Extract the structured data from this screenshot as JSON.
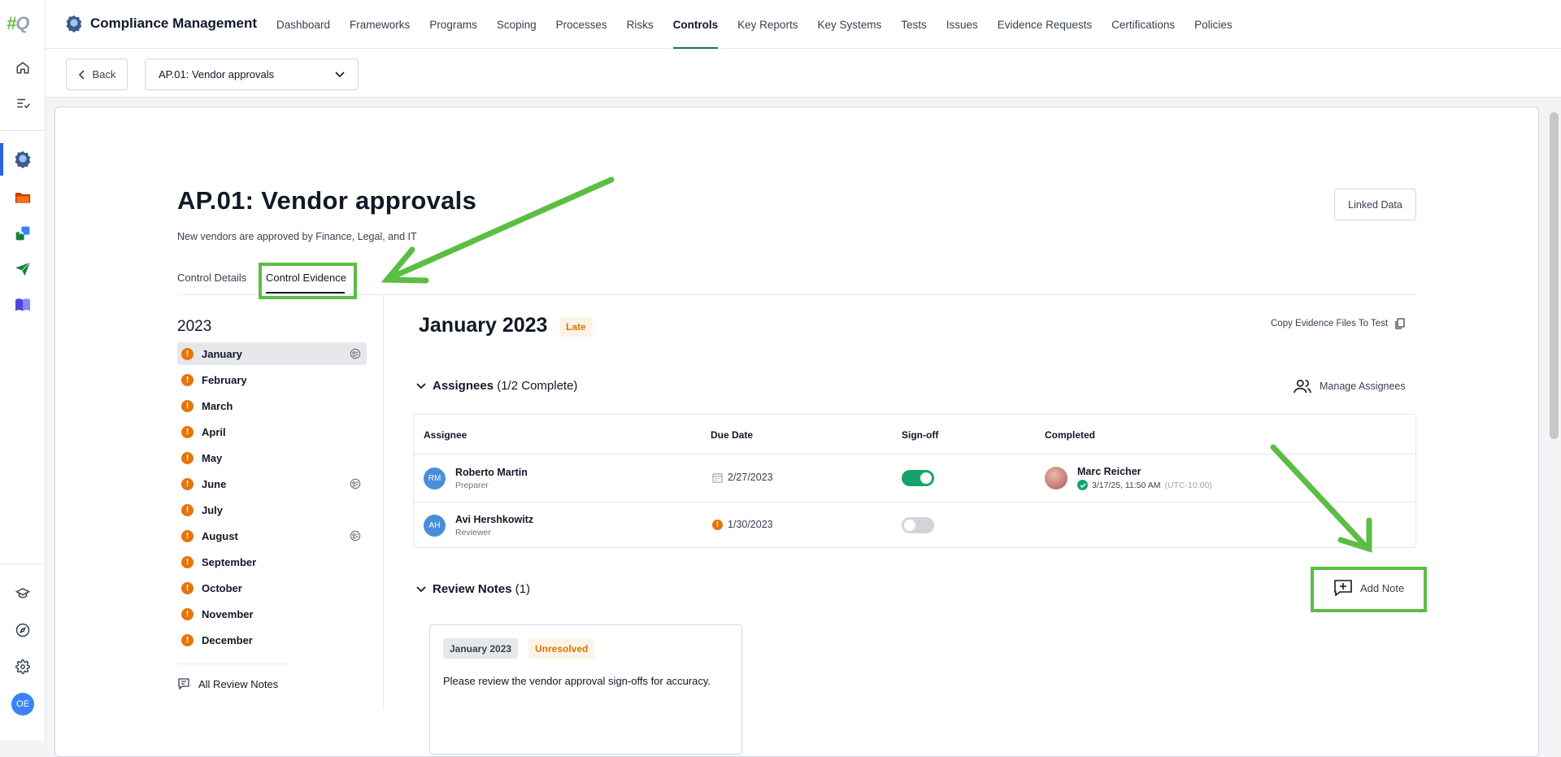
{
  "rail": {
    "logo_hash": "#",
    "logo_letter": "Q",
    "user_initials": "OE",
    "icons": [
      "home-icon",
      "tasks-icon",
      "compliance-badge-icon",
      "folder-icon",
      "sync-icon",
      "paper-plane-icon",
      "book-icon",
      "learning-icon",
      "compass-icon",
      "gear-icon"
    ]
  },
  "header": {
    "app_title": "Compliance Management",
    "nav": [
      "Dashboard",
      "Frameworks",
      "Programs",
      "Scoping",
      "Processes",
      "Risks",
      "Controls",
      "Key Reports",
      "Key Systems",
      "Tests",
      "Issues",
      "Evidence Requests",
      "Certifications",
      "Policies"
    ],
    "active_nav": "Controls"
  },
  "subbar": {
    "back_label": "Back",
    "control_select": "AP.01: Vendor approvals"
  },
  "control": {
    "title": "AP.01: Vendor approvals",
    "description": "New vendors are approved by Finance, Legal, and IT",
    "linked_data_label": "Linked Data",
    "tabs": [
      "Control Details",
      "Control Evidence"
    ],
    "active_tab": "Control Evidence"
  },
  "period_list": {
    "year": "2023",
    "months": [
      "January",
      "February",
      "March",
      "April",
      "May",
      "June",
      "July",
      "August",
      "September",
      "October",
      "November",
      "December"
    ],
    "active_month": "January",
    "months_with_notes": [
      "January",
      "June",
      "August"
    ],
    "all_notes_label": "All Review Notes"
  },
  "evidence": {
    "period_title": "January 2023",
    "status_badge": "Late",
    "copy_label": "Copy Evidence Files To Test",
    "assignees_heading": "Assignees",
    "assignees_count": "(1/2 Complete)",
    "manage_label": "Manage Assignees",
    "columns": [
      "Assignee",
      "Due Date",
      "Sign-off",
      "Completed"
    ],
    "rows": [
      {
        "initials": "RM",
        "name": "Roberto Martin",
        "role": "Preparer",
        "due": "2/27/2023",
        "signed_off": true,
        "completed_by": "Marc Reicher",
        "completed_at": "3/17/25, 11:50 AM",
        "completed_tz": "(UTC-10:00)"
      },
      {
        "initials": "AH",
        "name": "Avi Hershkowitz",
        "role": "Reviewer",
        "due": "1/30/2023",
        "signed_off": false
      }
    ],
    "notes_heading": "Review Notes",
    "notes_count": "(1)",
    "add_note_label": "Add Note",
    "note": {
      "period": "January 2023",
      "status": "Unresolved",
      "text": "Please review the vendor approval sign-offs for accuracy."
    }
  },
  "colors": {
    "accent_green": "#5cbd45",
    "warning_orange": "#e8740c",
    "success_green": "#16a36a",
    "avatar_blue": "#4a8ddb"
  }
}
